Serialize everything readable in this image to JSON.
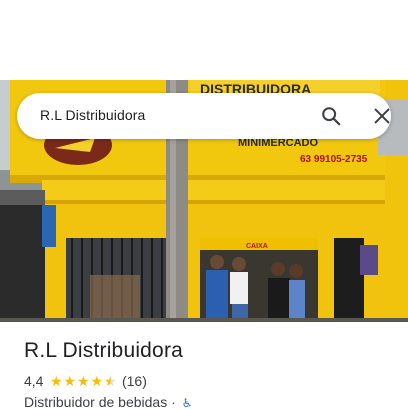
{
  "search": {
    "query": "R.L Distribuidora",
    "search_icon": "search-icon",
    "close_icon": "close-icon"
  },
  "photo": {
    "sign_text": "DISTRIBUIDORA",
    "sign_subtext": "MINIMERCADO",
    "phone": "63 99105-2735",
    "window_label": "CAIXA"
  },
  "place": {
    "name": "R.L Distribuidora",
    "rating": "4,4",
    "stars": 4.4,
    "review_count": "(16)",
    "category": "Distribuidor de bebidas ·",
    "accessibility_icon": "wheelchair-icon"
  },
  "colors": {
    "star": "#fbbc04",
    "storefront_yellow": "#f2c80f",
    "accent_blue": "#1a73e8"
  }
}
